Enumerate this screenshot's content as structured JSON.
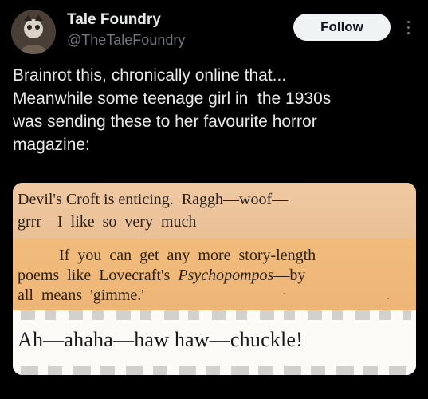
{
  "author": {
    "display_name": "Tale Foundry",
    "handle": "@TheTaleFoundry"
  },
  "actions": {
    "follow_label": "Follow",
    "more_icon": "more-vertical-icon"
  },
  "post": {
    "text_lines": [
      "Brainrot this, chronically online that...",
      "Meanwhile some teenage girl in  the 1930s",
      "was sending these to her favourite horror",
      "magazine:"
    ]
  },
  "media": {
    "clip1": {
      "line1": "Devil's Croft is enticing.  Raggh—woof—",
      "line2": "grrr—I  like  so  very  much"
    },
    "clip2": {
      "line1": "If  you  can  get  any  more  story-length",
      "line2": "poems  like  Lovecraft's  Psychopompos—by",
      "line3": "all  means  'gimme.'"
    },
    "clip3": {
      "line1": "Ah—ahaha—haw haw—chuckle!"
    }
  },
  "colors": {
    "background": "#000000",
    "text": "#e7e9ea",
    "muted": "#71767b",
    "follow_bg": "#eff3f4"
  }
}
